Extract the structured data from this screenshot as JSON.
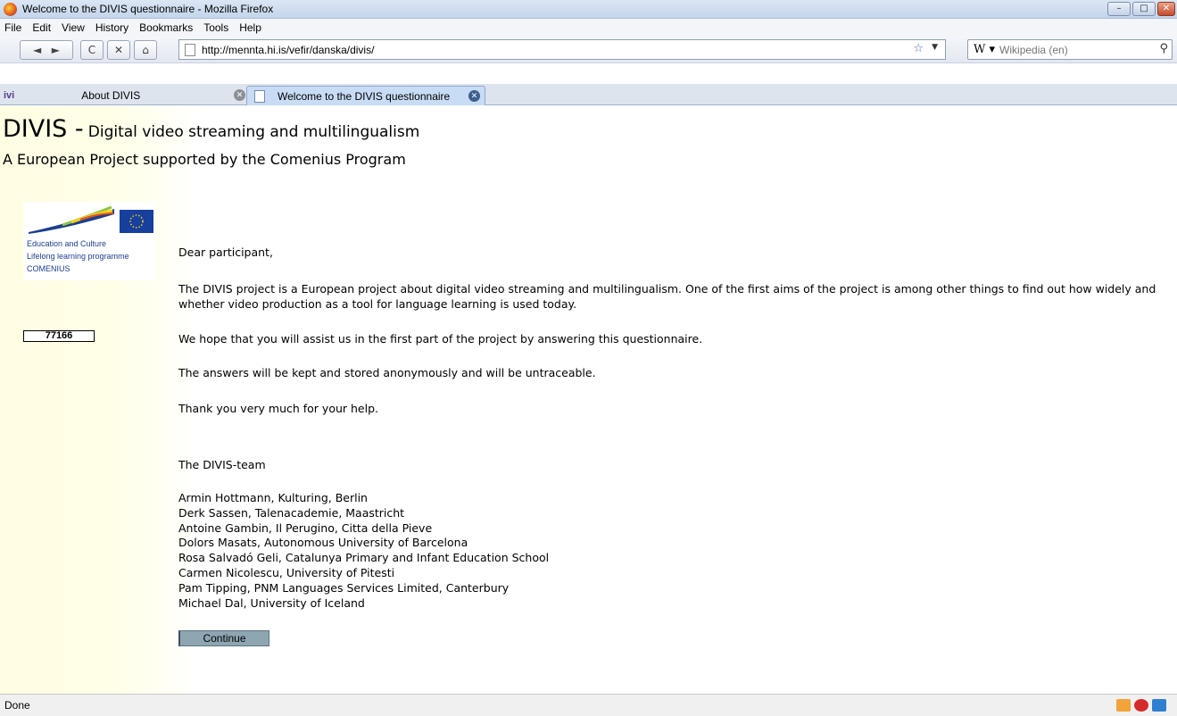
{
  "window": {
    "title": "Welcome to the DIVIS questionnaire - Mozilla Firefox",
    "controls": {
      "minimize": "–",
      "maximize": "□",
      "close": "✕"
    }
  },
  "menu": [
    "File",
    "Edit",
    "View",
    "History",
    "Bookmarks",
    "Tools",
    "Help"
  ],
  "nav": {
    "back": "◄",
    "forward": "►",
    "reload": "C",
    "stop": "✕",
    "home": "⌂",
    "url": "http://mennta.hi.is/vefir/danska/divis/",
    "search_engine": "W ▾",
    "search_placeholder": "Wikipedia (en)"
  },
  "tabs": [
    {
      "label": "About DIVIS",
      "logo": "ivi",
      "active": false
    },
    {
      "label": "Welcome to the DIVIS questionnaire",
      "active": true
    }
  ],
  "page": {
    "title_main": "DIVIS -",
    "title_tagline": "Digital video streaming and multilingualism",
    "subtitle": "A European Project supported by the Comenius Program",
    "logo_lines": [
      "Education and Culture",
      "Lifelong learning programme",
      "COMENIUS"
    ],
    "counter": "77166",
    "greeting": "Dear participant,",
    "paragraphs": [
      "The DIVIS project is a European project about digital video streaming and multilingualism. One of the first aims of the project is among other things to find out how widely and whether video production as a tool for language learning is used  today.",
      "We hope that you will assist us in the first part of the project by answering this questionnaire.",
      "The answers will be kept and stored anonymously and will be untraceable.",
      "Thank you very much for your help."
    ],
    "team_heading": "The DIVIS-team",
    "team": [
      "Armin Hottmann, Kulturing, Berlin",
      "Derk Sassen, Talenacademie, Maastricht",
      "Antoine Gambin, Il Perugino, Citta della Pieve",
      "Dolors Masats, Autonomous University of Barcelona",
      "Rosa Salvadó Geli, Catalunya Primary and Infant Education School",
      "Carmen Nicolescu, University of Pitesti",
      "Pam Tipping, PNM Languages Services Limited, Canterbury",
      "Michael Dal, University of Iceland"
    ],
    "continue_label": "Continue"
  },
  "status": {
    "text": "Done"
  },
  "colors": {
    "accent": "#8ea6b2",
    "sidebar": "#fffde2"
  }
}
